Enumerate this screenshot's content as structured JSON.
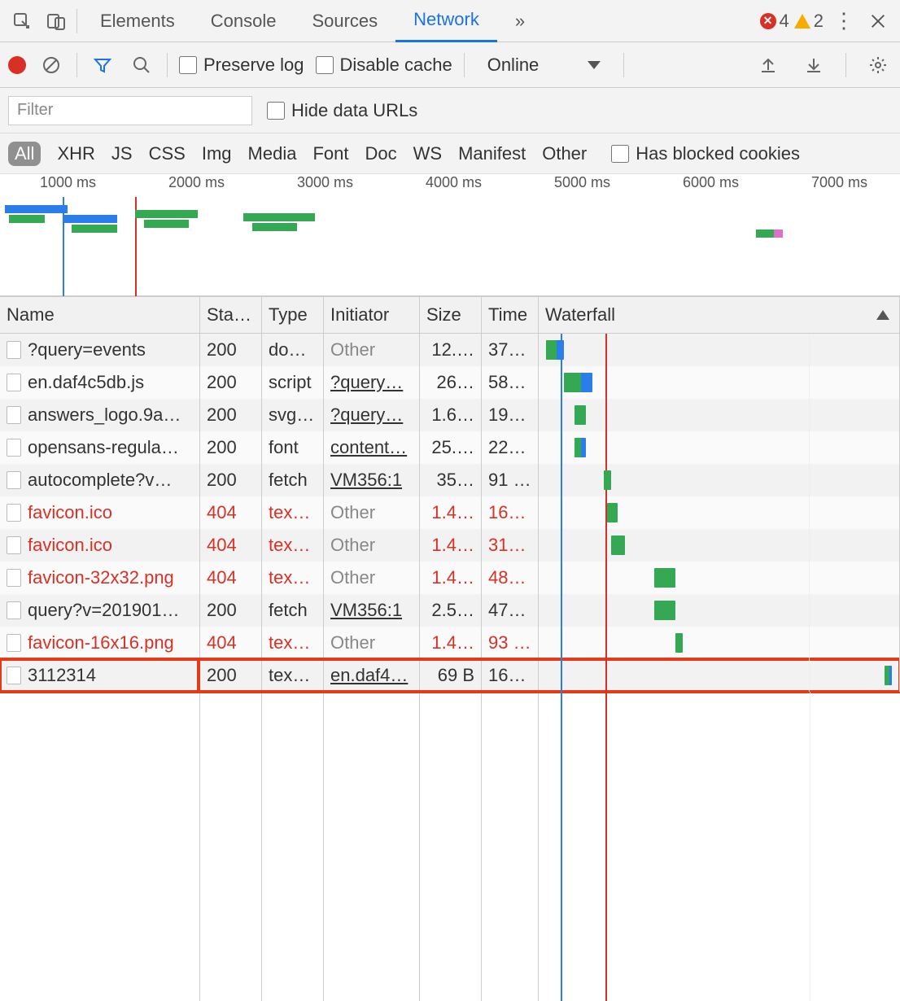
{
  "mainTabs": {
    "items": [
      "Elements",
      "Console",
      "Sources",
      "Network"
    ],
    "moreGlyph": "»",
    "active": 3
  },
  "status": {
    "errors": "4",
    "warnings": "2"
  },
  "toolbar": {
    "preserve": "Preserve log",
    "disableCache": "Disable cache",
    "throttle": "Online"
  },
  "filter": {
    "placeholder": "Filter",
    "hideData": "Hide data URLs"
  },
  "chips": [
    "All",
    "XHR",
    "JS",
    "CSS",
    "Img",
    "Media",
    "Font",
    "Doc",
    "WS",
    "Manifest",
    "Other"
  ],
  "hasBlocked": "Has blocked cookies",
  "timeline": {
    "ticks": [
      "1000 ms",
      "2000 ms",
      "3000 ms",
      "4000 ms",
      "5000 ms",
      "6000 ms",
      "7000 ms"
    ]
  },
  "columns": {
    "name": "Name",
    "status": "Sta…",
    "type": "Type",
    "initiator": "Initiator",
    "size": "Size",
    "time": "Time",
    "waterfall": "Waterfall"
  },
  "rows": [
    {
      "name": "?query=events",
      "status": "200",
      "type": "do…",
      "initiator": "Other",
      "initKind": "other",
      "size": "12.…",
      "time": "37…",
      "err": false,
      "wf": {
        "l": 2,
        "w": 5,
        "blue": true
      }
    },
    {
      "name": "en.daf4c5db.js",
      "status": "200",
      "type": "script",
      "initiator": "?query…",
      "initKind": "link",
      "size": "26…",
      "time": "58…",
      "err": false,
      "wf": {
        "l": 7,
        "w": 8,
        "blue": true
      }
    },
    {
      "name": "answers_logo.9a…",
      "status": "200",
      "type": "svg…",
      "initiator": "?query…",
      "initKind": "link",
      "size": "1.6…",
      "time": "19…",
      "err": false,
      "wf": {
        "l": 10,
        "w": 3
      }
    },
    {
      "name": "opensans-regula…",
      "status": "200",
      "type": "font",
      "initiator": "content…",
      "initKind": "link",
      "size": "25.…",
      "time": "22…",
      "err": false,
      "wf": {
        "l": 10,
        "w": 3,
        "blue": true
      }
    },
    {
      "name": "autocomplete?v…",
      "status": "200",
      "type": "fetch",
      "initiator": "VM356:1",
      "initKind": "link",
      "size": "35…",
      "time": "91 …",
      "err": false,
      "wf": {
        "l": 18,
        "w": 2
      }
    },
    {
      "name": "favicon.ico",
      "status": "404",
      "type": "tex…",
      "initiator": "Other",
      "initKind": "other",
      "size": "1.4…",
      "time": "16…",
      "err": true,
      "wf": {
        "l": 19,
        "w": 3
      }
    },
    {
      "name": "favicon.ico",
      "status": "404",
      "type": "tex…",
      "initiator": "Other",
      "initKind": "other",
      "size": "1.4…",
      "time": "31…",
      "err": true,
      "wf": {
        "l": 20,
        "w": 4
      }
    },
    {
      "name": "favicon-32x32.png",
      "status": "404",
      "type": "tex…",
      "initiator": "Other",
      "initKind": "other",
      "size": "1.4…",
      "time": "48…",
      "err": true,
      "wf": {
        "l": 32,
        "w": 6
      }
    },
    {
      "name": "query?v=201901…",
      "status": "200",
      "type": "fetch",
      "initiator": "VM356:1",
      "initKind": "link",
      "size": "2.5…",
      "time": "47…",
      "err": false,
      "wf": {
        "l": 32,
        "w": 6
      }
    },
    {
      "name": "favicon-16x16.png",
      "status": "404",
      "type": "tex…",
      "initiator": "Other",
      "initKind": "other",
      "size": "1.4…",
      "time": "93 …",
      "err": true,
      "wf": {
        "l": 38,
        "w": 2
      }
    },
    {
      "name": "3112314",
      "status": "200",
      "type": "tex…",
      "initiator": "en.daf4…",
      "initKind": "link",
      "size": "69 B",
      "time": "16…",
      "err": false,
      "wf": {
        "l": 96,
        "w": 2,
        "blue": true
      },
      "highlight": true
    }
  ]
}
